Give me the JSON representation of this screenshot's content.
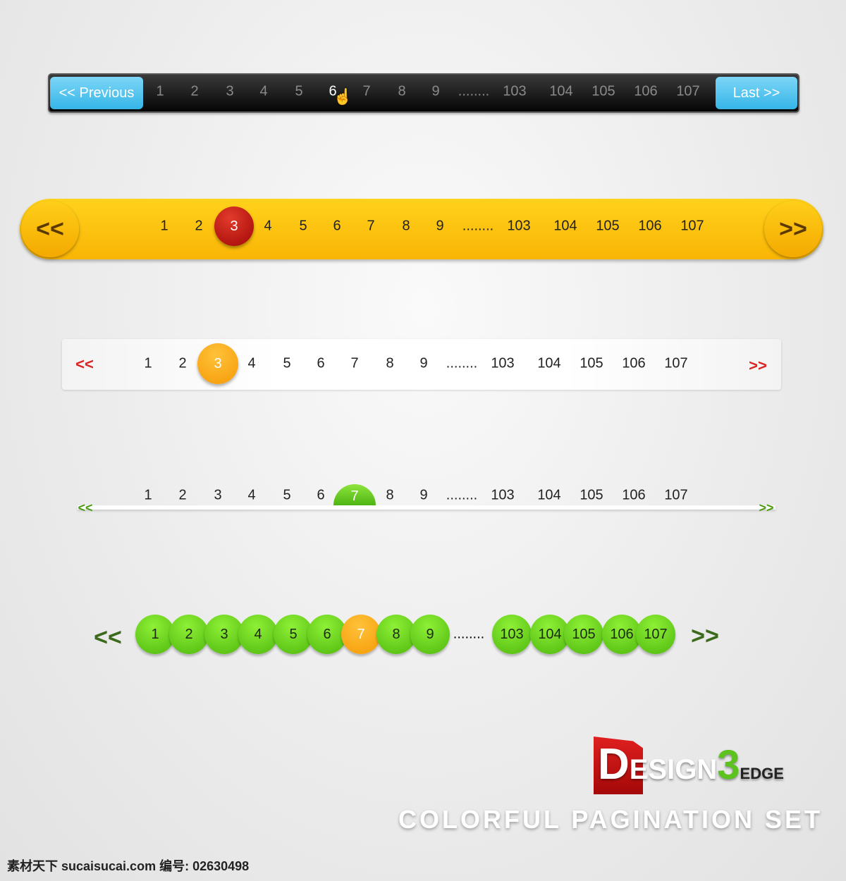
{
  "pages_left": [
    "1",
    "2",
    "3",
    "4",
    "5",
    "6",
    "7",
    "8",
    "9"
  ],
  "ellipsis": "........",
  "pages_right": [
    "103",
    "104",
    "105",
    "106",
    "107"
  ],
  "dark": {
    "prev_label": "<< Previous",
    "last_label": "Last >>",
    "hover_page": "6",
    "cursor_icon": "hand-pointer-icon"
  },
  "yellow": {
    "prev_label": "<<",
    "next_label": ">>",
    "current": "3"
  },
  "white": {
    "prev_label": "<<",
    "next_label": ">>",
    "current": "3"
  },
  "line": {
    "prev_label": "<<",
    "next_label": ">>",
    "current": "7"
  },
  "green": {
    "prev_label": "<<",
    "next_label": ">>",
    "current": "7"
  },
  "colors": {
    "blue": "#35b5e8",
    "yellow": "#f9b404",
    "red": "#a10707",
    "orange": "#f59a06",
    "green": "#4fb80e"
  },
  "branding": {
    "logo": "DESIGN3EDGE",
    "tagline": "COLORFUL PAGINATION SET"
  },
  "watermark": "素材天下 sucaisucai.com  编号: 02630498"
}
